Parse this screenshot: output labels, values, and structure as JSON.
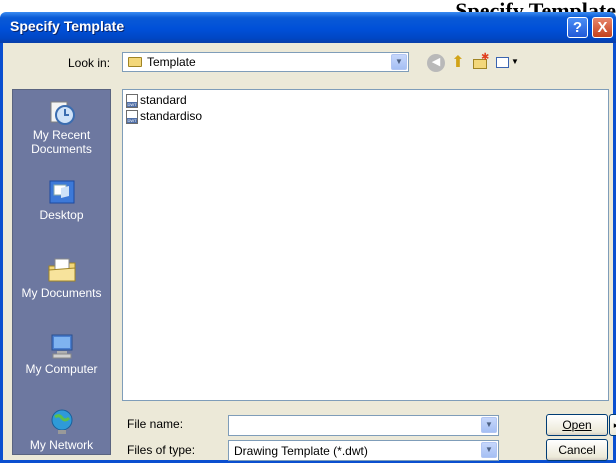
{
  "page_heading": "Specify Template",
  "dialog": {
    "title": "Specify Template",
    "help_button": "?",
    "close_button": "X"
  },
  "look_in": {
    "label": "Look in:",
    "value": "Template"
  },
  "toolbar": {
    "back_icon": "back-arrow-icon",
    "up_icon": "up-folder-icon",
    "new_folder_icon": "new-folder-icon",
    "views_icon": "views-menu-icon"
  },
  "places": [
    {
      "label": "My Recent Documents",
      "icon": "recent-documents-icon"
    },
    {
      "label": "Desktop",
      "icon": "desktop-icon"
    },
    {
      "label": "My Documents",
      "icon": "my-documents-icon"
    },
    {
      "label": "My Computer",
      "icon": "my-computer-icon"
    },
    {
      "label": "My Network",
      "icon": "my-network-icon"
    }
  ],
  "files": [
    {
      "name": "standard",
      "icon_text": "DWT"
    },
    {
      "name": "standardiso",
      "icon_text": "DWT"
    }
  ],
  "file_name": {
    "label": "File name:",
    "value": ""
  },
  "file_type": {
    "label": "Files of type:",
    "value": "Drawing Template (*.dwt)"
  },
  "buttons": {
    "open": "Open",
    "more": "▸",
    "cancel": "Cancel"
  },
  "colors": {
    "titlebar": "#0a5ad6",
    "dialog_face": "#ece9d8",
    "places_bar": "#6d78a0",
    "field_border": "#7f9db9"
  }
}
